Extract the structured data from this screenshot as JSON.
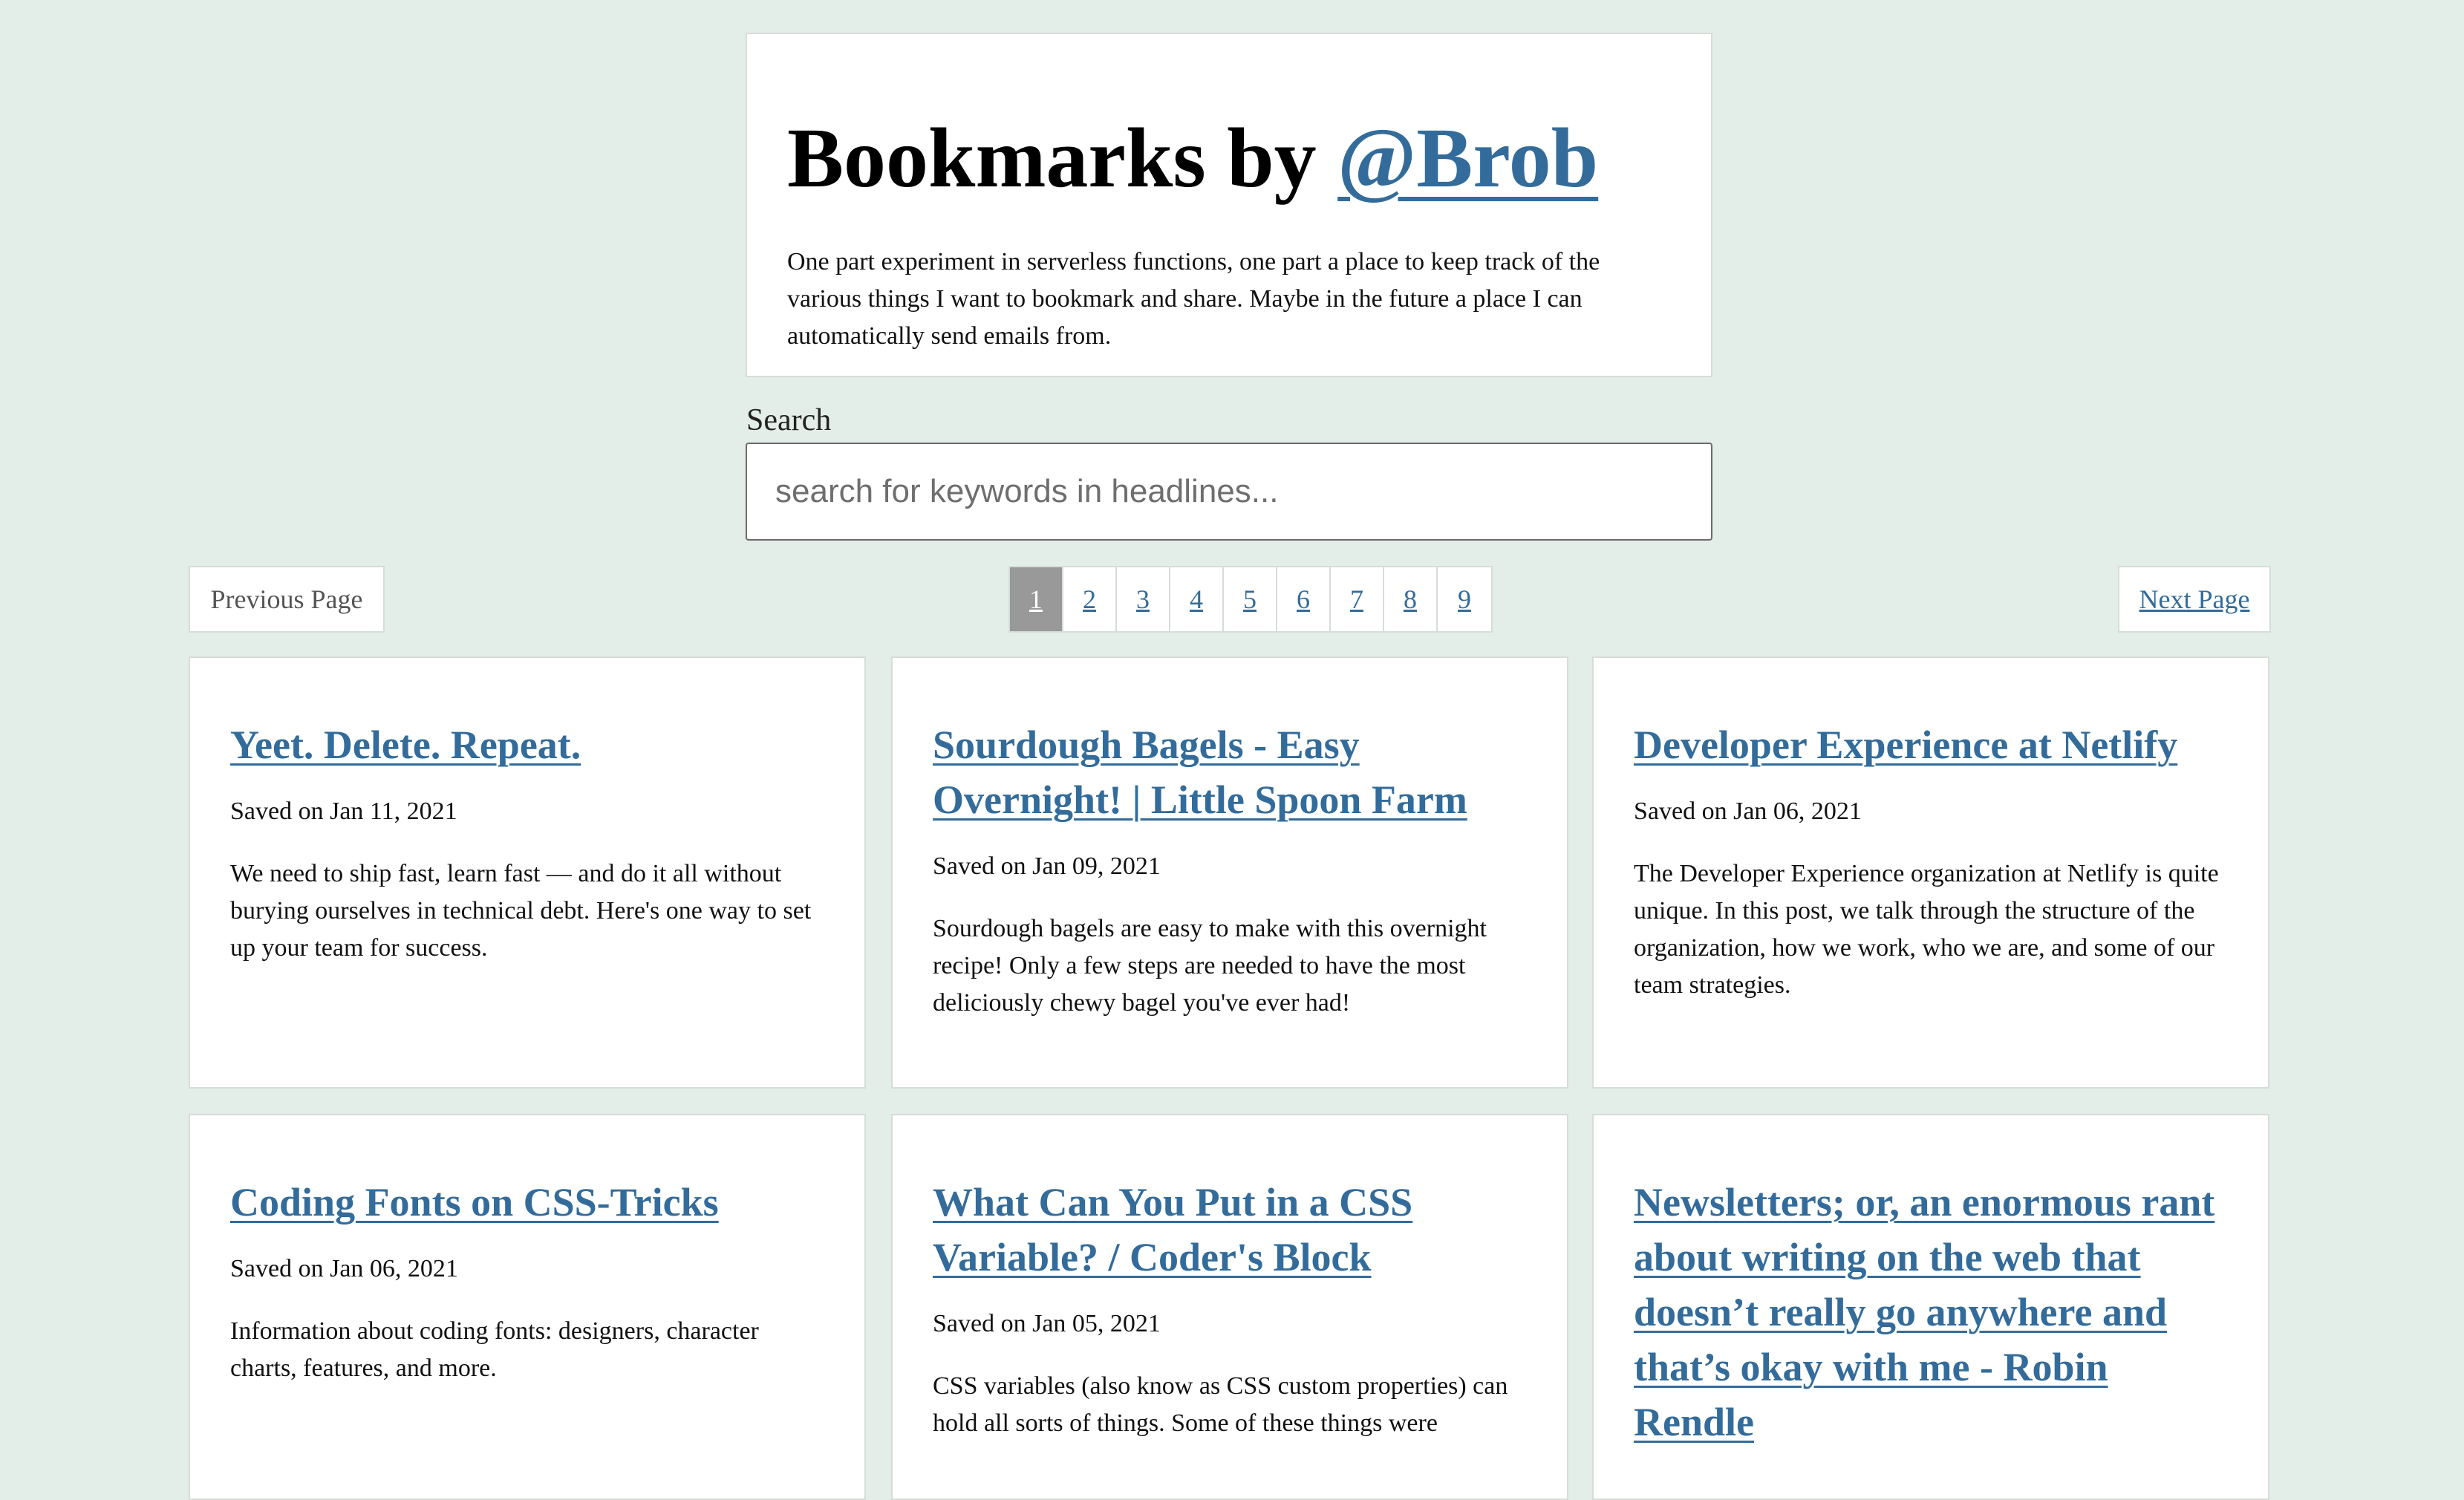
{
  "header": {
    "title_prefix": "Bookmarks by ",
    "author_handle": "@Brob",
    "description": "One part experiment in serverless functions, one part a place to keep track of the various things I want to bookmark and share. Maybe in the future a place I can automatically send emails from."
  },
  "search": {
    "label": "Search",
    "placeholder": "search for keywords in headlines...",
    "value": ""
  },
  "pagination": {
    "previous_label": "Previous Page",
    "next_label": "Next Page",
    "current_page": "1",
    "pages": [
      "1",
      "2",
      "3",
      "4",
      "5",
      "6",
      "7",
      "8",
      "9"
    ]
  },
  "bookmarks": [
    {
      "title": "Yeet. Delete. Repeat.",
      "saved": "Saved on Jan 11, 2021",
      "summary": "We need to ship fast, learn fast — and do it all without burying ourselves in technical debt. Here's one way to set up your team for success."
    },
    {
      "title": "Sourdough Bagels - Easy Overnight! | Little Spoon Farm",
      "saved": "Saved on Jan 09, 2021",
      "summary": "Sourdough bagels are easy to make with this overnight recipe! Only a few steps are needed to have the most deliciously chewy bagel you've ever had!"
    },
    {
      "title": "Developer Experience at Netlify",
      "saved": "Saved on Jan 06, 2021",
      "summary": "The Developer Experience organization at Netlify is quite unique. In this post, we talk through the structure of the organization, how we work, who we are, and some of our team strategies."
    },
    {
      "title": "Coding Fonts on CSS-Tricks",
      "saved": "Saved on Jan 06, 2021",
      "summary": "Information about coding fonts: designers, character charts, features, and more."
    },
    {
      "title": "What Can You Put in a CSS Variable? / Coder's Block",
      "saved": "Saved on Jan 05, 2021",
      "summary": "CSS variables (also know as CSS custom properties) can hold all sorts of things. Some of these things were"
    },
    {
      "title": "Newsletters; or, an enormous rant about writing on the web that doesn’t really go anywhere and that’s okay with me - Robin Rendle",
      "saved": "",
      "summary": ""
    }
  ],
  "colors": {
    "background": "#e4eee8",
    "link": "#336c9b",
    "active_page": "#999999"
  }
}
